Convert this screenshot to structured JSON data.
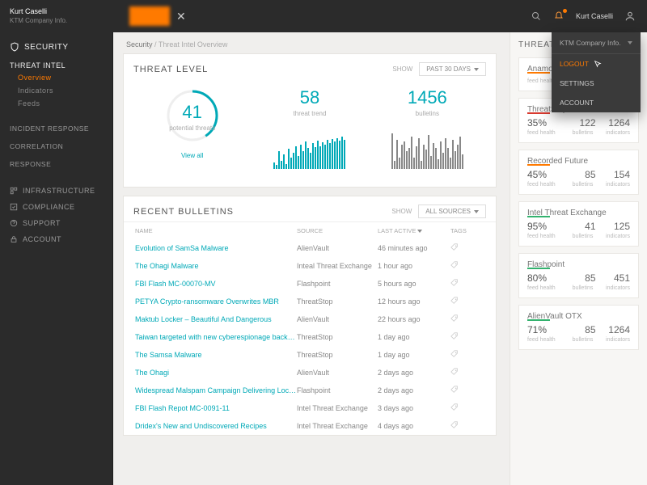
{
  "topbar": {
    "user_name": "Kurt Caselli",
    "user_org": "KTM Company Info.",
    "close_label": "✕"
  },
  "user_menu": {
    "org": "KTM Company Info.",
    "logout": "LOGOUT",
    "settings": "SETTINGS",
    "account": "ACCOUNT"
  },
  "sidebar": {
    "security": "SECURITY",
    "threat_intel": "THREAT INTEL",
    "subs": [
      "Overview",
      "Indicators",
      "Feeds"
    ],
    "items": [
      "INCIDENT RESPONSE",
      "CORRELATION",
      "RESPONSE"
    ],
    "bottom": [
      "INFRASTRUCTURE",
      "COMPLIANCE",
      "SUPPORT",
      "ACCOUNT"
    ]
  },
  "breadcrumb": {
    "b1": "Security",
    "b2": "Threat Intel Overview"
  },
  "threat_panel": {
    "title": "THREAT LEVEL",
    "show": "SHOW",
    "range": "PAST 30 DAYS",
    "m1_value": "41",
    "m1_label": "potential threats",
    "m1_link": "View all",
    "m2_value": "58",
    "m2_label": "threat trend",
    "m3_value": "1456",
    "m3_label": "bulletins"
  },
  "bulletins_panel": {
    "title": "RECENT BULLETINS",
    "show": "SHOW",
    "src_filter": "ALL SOURCES",
    "cols": {
      "name": "NAME",
      "source": "SOURCE",
      "last": "LAST ACTIVE",
      "tags": "TAGS"
    },
    "rows": [
      {
        "name": "Evolution of SamSa Malware",
        "source": "AlienVault",
        "last": "46 minutes ago"
      },
      {
        "name": "The Ohagi Malware",
        "source": "Inteal Threat Exchange",
        "last": "1 hour ago"
      },
      {
        "name": "FBI Flash MC-00070-MV",
        "source": "Flashpoint",
        "last": "5 hours ago"
      },
      {
        "name": "PETYA Crypto-ransomware Overwrites MBR",
        "source": "ThreatStop",
        "last": "12 hours ago"
      },
      {
        "name": "Maktub Locker – Beautiful And Dangerous",
        "source": "AlienVault",
        "last": "22 hours ago"
      },
      {
        "name": "Taiwan targeted with new cyberespionage backdoor…",
        "source": "ThreatStop",
        "last": "1 day ago"
      },
      {
        "name": "The Samsa Malware",
        "source": "ThreatStop",
        "last": "1 day ago"
      },
      {
        "name": "The Ohagi",
        "source": "AlienVault",
        "last": "2 days ago"
      },
      {
        "name": "Widespread Malspam Campaign Delivering Locky…",
        "source": "Flashpoint",
        "last": "2 days ago"
      },
      {
        "name": "FBI Flash Repot MC-0091-11",
        "source": "Intel Threat Exchange",
        "last": "3 days ago"
      },
      {
        "name": "Dridex's New and Undiscovered Recipes",
        "source": "Intel Threat Exchange",
        "last": "4 days ago"
      }
    ]
  },
  "rail": {
    "title": "THREAT I",
    "labels": {
      "feed": "feed health",
      "bul": "bulletins",
      "ind": "indicators"
    },
    "cards": [
      {
        "name": "Anamoly",
        "color": "orange",
        "pct": "",
        "bul": "",
        "ind": ""
      },
      {
        "name": "ThreatStop",
        "color": "red",
        "pct": "35%",
        "bul": "122",
        "ind": "1264"
      },
      {
        "name": "Recorded Future",
        "color": "orange",
        "pct": "45%",
        "bul": "85",
        "ind": "154"
      },
      {
        "name": "Intel Threat Exchange",
        "color": "green",
        "pct": "95%",
        "bul": "41",
        "ind": "125"
      },
      {
        "name": "Flashpoint",
        "color": "green",
        "pct": "80%",
        "bul": "85",
        "ind": "451"
      },
      {
        "name": "AlienVault OTX",
        "color": "green",
        "pct": "71%",
        "bul": "85",
        "ind": "1264"
      }
    ]
  },
  "chart_data": {
    "ring": {
      "type": "pie",
      "values": [
        41,
        100
      ],
      "title": "potential threats"
    },
    "trend": {
      "type": "bar",
      "title": "threat trend",
      "values": [
        8,
        5,
        22,
        10,
        18,
        6,
        25,
        14,
        20,
        28,
        16,
        30,
        22,
        34,
        26,
        20,
        32,
        27,
        35,
        28,
        33,
        30,
        36,
        32,
        37,
        34,
        38,
        35,
        40,
        36
      ]
    },
    "bulletins_spark": {
      "type": "bar",
      "title": "bulletins",
      "values": [
        44,
        10,
        36,
        14,
        30,
        34,
        22,
        26,
        40,
        14,
        28,
        38,
        10,
        30,
        24,
        42,
        16,
        32,
        26,
        12,
        34,
        20,
        38,
        26,
        14,
        36,
        22,
        30,
        40,
        18
      ]
    }
  }
}
